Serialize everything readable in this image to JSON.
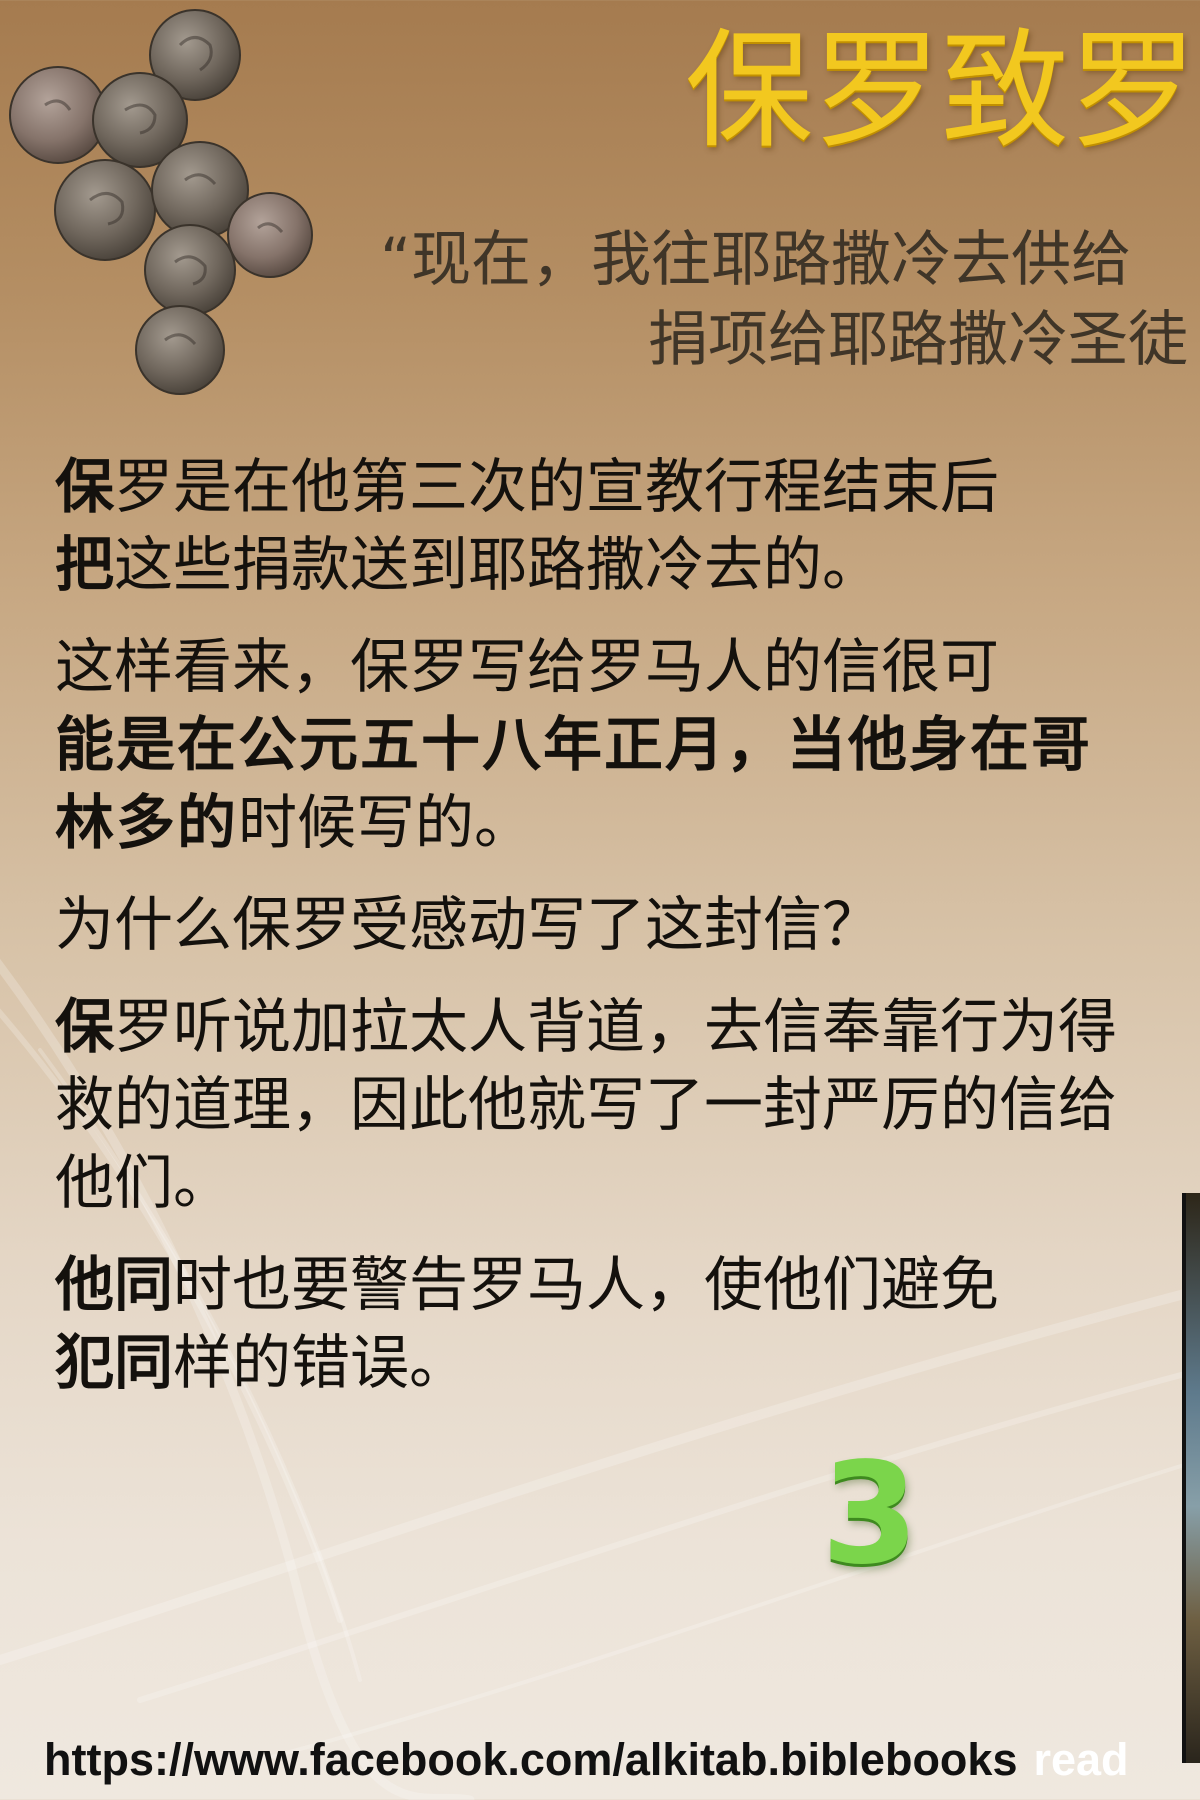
{
  "slide": {
    "title": "保罗致罗",
    "quote": {
      "line1": "“现在，我往耶路撒冷去供给",
      "line2": "捐项给耶路撒冷圣徒"
    },
    "paragraphs": [
      {
        "lead": "保",
        "rest": "罗是在他第三次的宣教行程结束后",
        "lead2": "把",
        "rest2": "这些捐款送到耶路撒冷去的。"
      },
      {
        "normal": "这样看来，保罗写给罗马人的信很可",
        "bold": "能是在公元五十八年正月，当他身在哥林多的",
        "end": "时候写的。"
      },
      {
        "text": "为什么保罗受感动写了这封信？"
      },
      {
        "lead": "保",
        "rest": "罗听说加拉太人背道，去信奉靠行为得救的道理，因此他就写了一封严厉的信给他们。"
      },
      {
        "lead": "他同",
        "rest": "时也要警告罗马人，使他们避免",
        "lead2": "犯同",
        "rest2": "样的错误。"
      }
    ],
    "page_number": "3",
    "footer_url": "https://www.facebook.com/alkitab.biblebooks",
    "footer_extra": "read"
  },
  "colors": {
    "title": "#f2c81f",
    "page_number": "#7bd54b",
    "body_text": "#14110d",
    "quote_text": "#3f3528"
  },
  "icons": {
    "coins": "ancient-coins-image",
    "photo": "photo-thumbnail"
  }
}
